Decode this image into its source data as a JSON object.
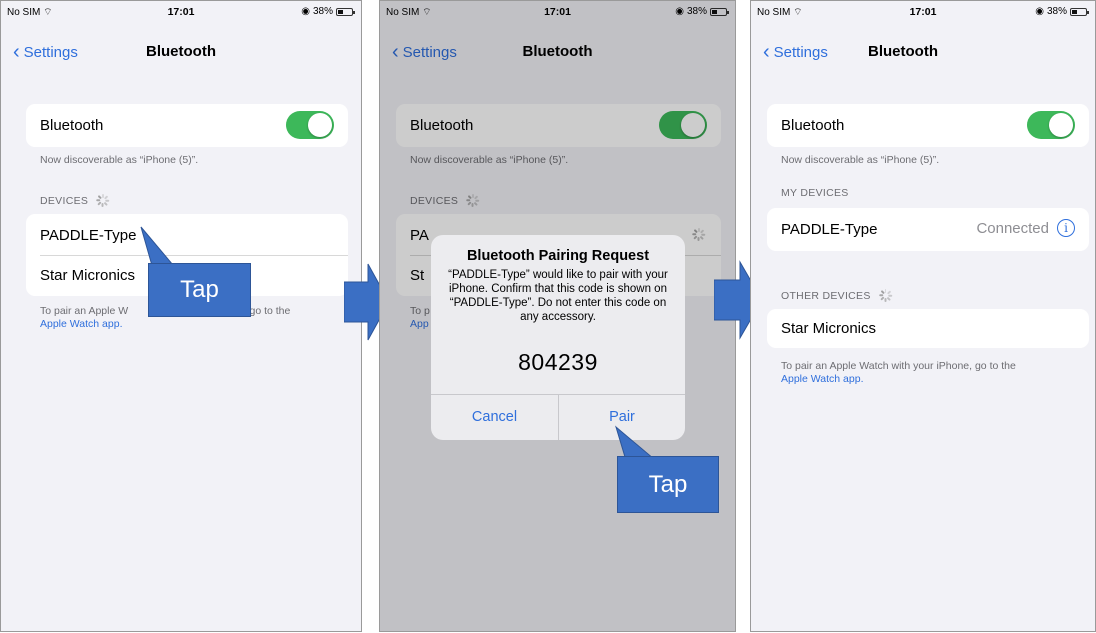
{
  "status_bar": {
    "carrier": "No SIM",
    "time": "17:01",
    "battery": "38%"
  },
  "nav": {
    "back_label": "Settings",
    "title": "Bluetooth"
  },
  "bluetooth": {
    "label": "Bluetooth",
    "enabled": true,
    "discoverable_text": "Now discoverable as “iPhone (5)”."
  },
  "screen1": {
    "devices_header": "DEVICES",
    "devices": [
      "PADDLE-Type",
      "Star Micronics"
    ],
    "footer_prefix": "To pair an Apple W",
    "footer_suffix": "one, go to the",
    "footer_link": "Apple Watch app."
  },
  "screen2": {
    "devices_header": "DEVICES",
    "device1_partial": "PA",
    "device2_partial": "St",
    "footer_left": "To p",
    "footer_right": "he",
    "footer_link_partial": "App"
  },
  "alert": {
    "title": "Bluetooth Pairing Request",
    "message": "“PADDLE-Type” would like to pair with your iPhone. Confirm that this code is shown on “PADDLE-Type”. Do not enter this code on any accessory.",
    "code": "804239",
    "cancel_label": "Cancel",
    "pair_label": "Pair"
  },
  "screen3": {
    "my_devices_header": "MY DEVICES",
    "my_device_name": "PADDLE-Type",
    "my_device_status": "Connected",
    "other_devices_header": "OTHER DEVICES",
    "other_device_name": "Star Micronics",
    "footer_text": "To pair an Apple Watch with your iPhone, go to the",
    "footer_link": "Apple Watch app."
  },
  "callouts": {
    "tap1": "Tap",
    "tap2": "Tap"
  },
  "colors": {
    "accent": "#2f6fdc",
    "toggle_on": "#3db85a",
    "callout": "#3b6fc4"
  }
}
